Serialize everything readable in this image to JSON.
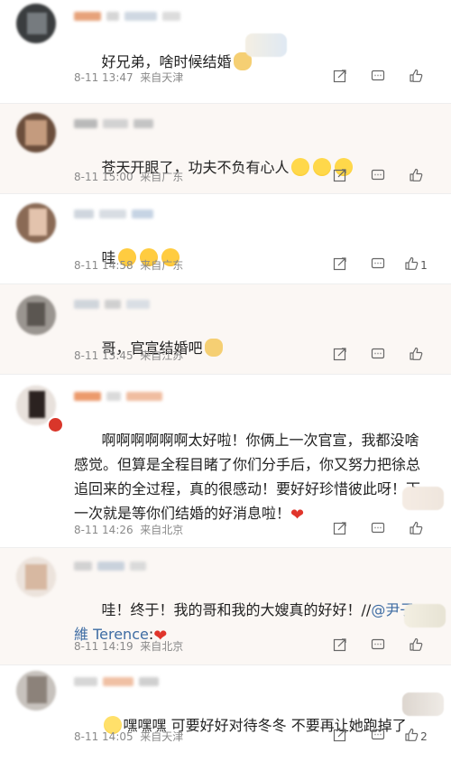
{
  "comments": [
    {
      "text": "好兄弟，啥时候结婚",
      "time": "8-11 13:47",
      "source": "来自天津",
      "likes": ""
    },
    {
      "text": "苍天开眼了，功夫不负有心人",
      "time": "8-11 15:00",
      "source": "来自广东",
      "likes": ""
    },
    {
      "text": "哇",
      "time": "8-11 14:58",
      "source": "来自广东",
      "likes": "1"
    },
    {
      "text": "哥，官宣结婚吧",
      "time": "8-11 13:45",
      "source": "来自江苏",
      "likes": ""
    },
    {
      "text": "啊啊啊啊啊啊太好啦！你俩上一次官宣，我都没啥感觉。但算是全程目睹了你们分手后，你又努力把徐总追回来的全过程，真的很感动！要好好珍惜彼此呀！下一次就是等你们结婚的好消息啦！",
      "time": "8-11 14:26",
      "source": "来自北京",
      "likes": ""
    },
    {
      "text": "哇！终于！我的哥和我的大嫂真的好好！//",
      "mention": "@尹子維 Terence",
      "after_mention": ":",
      "time": "8-11 14:19",
      "source": "来自北京",
      "likes": ""
    },
    {
      "text": "嘿嘿嘿 可要好好对待冬冬 不要再让她跑掉了",
      "time": "8-11 14:05",
      "source": "来自天津",
      "likes": "2"
    }
  ],
  "icons": {
    "share": "share-icon",
    "comment": "comment-icon",
    "like": "like-icon"
  },
  "colors": {
    "mention": "#3e6ca3",
    "meta": "#8a8a8a",
    "heart": "#e0352b"
  }
}
